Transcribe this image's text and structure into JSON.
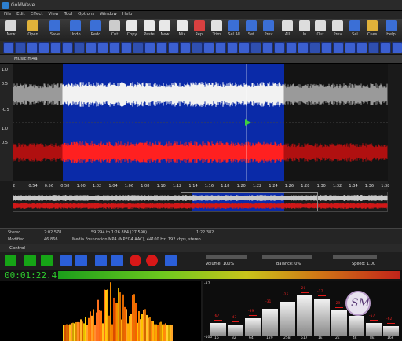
{
  "window": {
    "title": "GoldWave"
  },
  "menu": [
    "File",
    "Edit",
    "Effect",
    "View",
    "Tool",
    "Options",
    "Window",
    "Help"
  ],
  "toolbar": [
    {
      "label": "New",
      "icon": "new-file-icon",
      "color": "#d8d8d8"
    },
    {
      "label": "Open",
      "icon": "folder-icon",
      "color": "#e0b23a"
    },
    {
      "label": "Save",
      "icon": "save-icon",
      "color": "#3b6fd6"
    },
    {
      "label": "Undo",
      "icon": "undo-icon",
      "color": "#3b6fd6"
    },
    {
      "label": "Redo",
      "icon": "redo-icon",
      "color": "#3b6fd6"
    },
    {
      "label": "Cut",
      "icon": "cut-icon",
      "color": "#cccccc"
    },
    {
      "label": "Copy",
      "icon": "copy-icon",
      "color": "#e8e8e8"
    },
    {
      "label": "Paste",
      "icon": "paste-icon",
      "color": "#e8e8e8"
    },
    {
      "label": "New",
      "icon": "paste-new-icon",
      "color": "#e8e8e8"
    },
    {
      "label": "Mix",
      "icon": "mix-icon",
      "color": "#e8e8e8"
    },
    {
      "label": "Repl",
      "icon": "replace-icon",
      "color": "#d84040"
    },
    {
      "label": "Trim",
      "icon": "trim-icon",
      "color": "#e0e0e0"
    },
    {
      "label": "Sel All",
      "icon": "select-all-icon",
      "color": "#3b6fd6"
    },
    {
      "label": "Set",
      "icon": "set-icon",
      "color": "#3b6fd6"
    },
    {
      "label": "Prev",
      "icon": "prev-icon",
      "color": "#3b6fd6"
    },
    {
      "label": "All",
      "icon": "zoom-all-icon",
      "color": "#dddddd"
    },
    {
      "label": "In",
      "icon": "zoom-in-icon",
      "color": "#dddddd"
    },
    {
      "label": "Out",
      "icon": "zoom-out-icon",
      "color": "#dddddd"
    },
    {
      "label": "Prev",
      "icon": "zoom-prev-icon",
      "color": "#dddddd"
    },
    {
      "label": "Sel",
      "icon": "zoom-sel-icon",
      "color": "#3b6fd6"
    },
    {
      "label": "Cues",
      "icon": "cues-icon",
      "color": "#e0b23a"
    },
    {
      "label": "Help",
      "icon": "help-icon",
      "color": "#3b6fd6"
    }
  ],
  "document": {
    "title": "Music.m4a"
  },
  "scale": {
    "top": [
      "1.0",
      "0.5",
      "-0.5",
      "1"
    ],
    "bottom": [
      "1.0",
      "0.5",
      "0.5",
      "1"
    ]
  },
  "timeline": [
    "2",
    "0:54",
    "0:56",
    "0:58",
    "1:00",
    "1:02",
    "1:04",
    "1:06",
    "1:08",
    "1:10",
    "1:12",
    "1:14",
    "1:16",
    "1:18",
    "1:20",
    "1:22",
    "1:24",
    "1:26",
    "1:28",
    "1:30",
    "1:32",
    "1:34",
    "1:36",
    "1:38"
  ],
  "status": {
    "row1": [
      "Stereo",
      "2:02.578",
      "59.294 to 1:26.884 (27.590)",
      "1:22.382"
    ],
    "row2": [
      "Modified",
      "46.866",
      "Media Foundation MP4 (MPEG4 AAC), 44100 Hz, 192 kbps, stereo"
    ]
  },
  "control": {
    "title": "Control",
    "volume": "Volume: 100%",
    "balance": "Balance: 0%",
    "speed": "Speed: 1.00",
    "counter": "00:01:22.4"
  },
  "equalizer": {
    "bands": [
      "16",
      "32",
      "64",
      "129",
      "258",
      "517",
      "1k",
      "2k",
      "4k",
      "8k",
      "16k"
    ],
    "levels": [
      0.25,
      0.22,
      0.35,
      0.55,
      0.7,
      0.82,
      0.75,
      0.52,
      0.4,
      0.25,
      0.2
    ],
    "peaks": [
      "-67",
      "-47",
      "-39",
      "-31",
      "-25",
      "-20",
      "-17",
      "-29",
      "-44",
      "-57",
      "-62"
    ],
    "scale_top": "-37",
    "scale_bottom": "-100"
  },
  "colors": {
    "selection": "#0a2aa8",
    "left_channel": "#cfcfcf",
    "right_channel": "#d81818",
    "accent_green": "#2fd02f"
  }
}
